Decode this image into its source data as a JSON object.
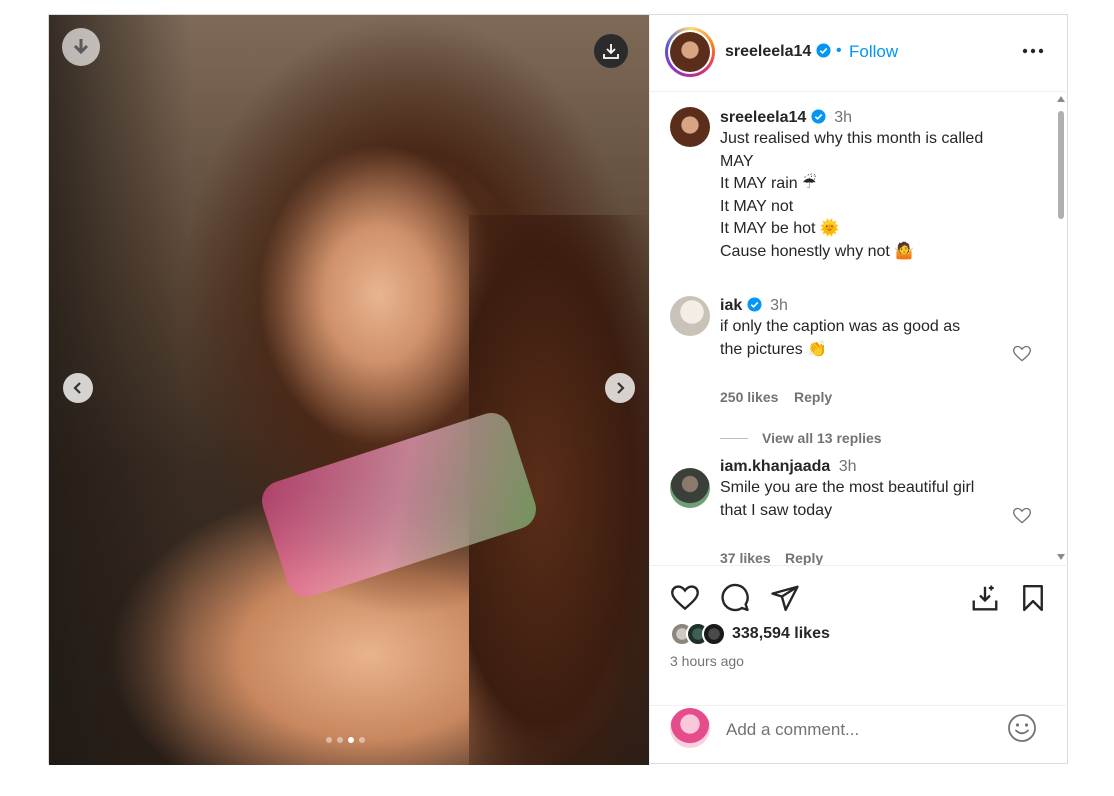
{
  "photo": {
    "alt": "",
    "carousel": {
      "count": 4,
      "active_index": 2
    }
  },
  "header": {
    "username": "sreeleela14",
    "separator": "•",
    "follow_label": "Follow"
  },
  "caption": {
    "username": "sreeleela14",
    "time": "3h",
    "lines": [
      "Just realised why this month is called",
      "MAY",
      "It MAY rain ☔",
      "It MAY not",
      "It MAY be hot 🌞",
      "Cause honestly why not 🤷"
    ]
  },
  "comments": [
    {
      "username": "iak",
      "verified": true,
      "time": "3h",
      "text_lines": [
        "if only the caption was as good as",
        "the pictures 👏"
      ],
      "likes": "250 likes",
      "reply_label": "Reply",
      "view_replies": "View all 13 replies"
    },
    {
      "username": "iam.khanjaada",
      "verified": false,
      "time": "3h",
      "text_lines": [
        "Smile you are the most beautiful girl",
        "that I saw today"
      ],
      "likes": "37 likes",
      "reply_label": "Reply"
    }
  ],
  "stats": {
    "likes": "338,594 likes",
    "time_ago": "3 hours ago"
  },
  "add_comment": {
    "placeholder": "Add a comment..."
  },
  "icons": {
    "like": "heart-icon",
    "comment": "comment-icon",
    "share": "send-icon",
    "download": "download-icon",
    "save": "bookmark-icon",
    "emoji": "emoji-icon",
    "more": "more-icon"
  },
  "colors": {
    "accent": "#0095f6",
    "text": "#262626",
    "muted": "#737373",
    "border": "#dbdbdb"
  }
}
